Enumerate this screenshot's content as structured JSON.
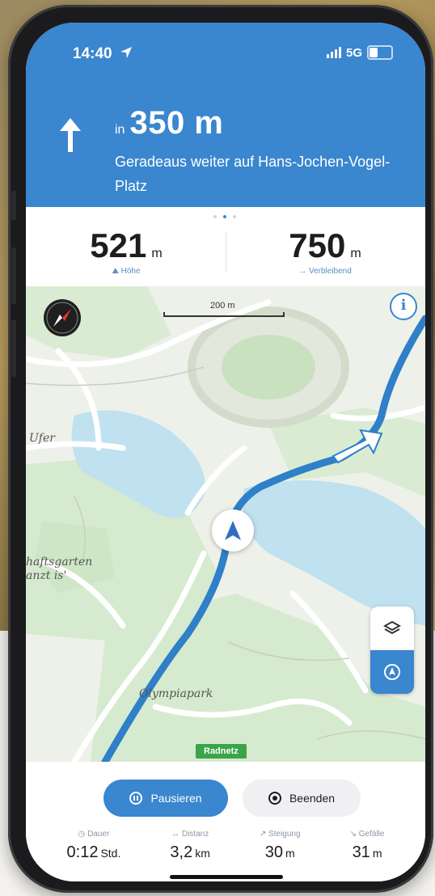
{
  "colors": {
    "primary": "#3a86cf",
    "route": "#2f7fc9",
    "park": "#d6ead0",
    "water": "#bfe1f0",
    "badge": "#3aa449"
  },
  "status_bar": {
    "time": "14:40",
    "network": "5G"
  },
  "instruction": {
    "maneuver_icon": "arrow-straight-icon",
    "prefix": "in",
    "distance": "350 m",
    "street": "Geradeaus weiter auf Hans-Jochen-Vogel-Platz"
  },
  "stats": {
    "page_dots": 3,
    "active_dot": 1,
    "altitude": {
      "value": "521",
      "unit": "m",
      "label": "Höhe"
    },
    "remaining": {
      "value": "750",
      "unit": "m",
      "label": "Verbleibend"
    }
  },
  "map": {
    "scale_label": "200 m",
    "labels": {
      "ufer": "Ufer",
      "garten1": "haftsgarten",
      "garten2": "anzt is'",
      "park": "Olympiapark"
    },
    "badge": "Radnetz",
    "info_glyph": "i",
    "layers_icon": "layers-icon",
    "recenter_icon": "location-icon"
  },
  "controls": {
    "pause_label": "Pausieren",
    "stop_label": "Beenden"
  },
  "trip": [
    {
      "label": "Dauer",
      "value": "0:12",
      "unit": "Std."
    },
    {
      "label": "Distanz",
      "value": "3,2",
      "unit": "km"
    },
    {
      "label": "Steigung",
      "value": "30",
      "unit": "m"
    },
    {
      "label": "Gefälle",
      "value": "31",
      "unit": "m"
    }
  ]
}
